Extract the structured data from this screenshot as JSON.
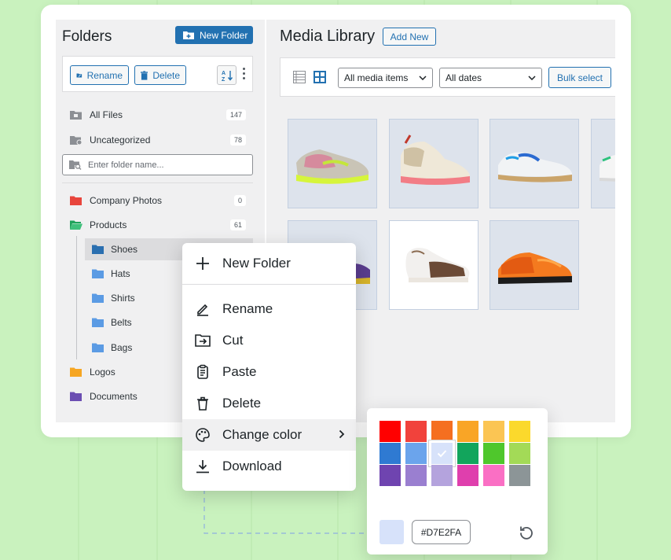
{
  "colors": {
    "accent": "#2271b1",
    "page_bg": "#c9f2be",
    "panel_bg": "#f0f0f1"
  },
  "sidebar": {
    "title": "Folders",
    "new_folder_label": "New Folder",
    "rename_label": "Rename",
    "delete_label": "Delete",
    "search_placeholder": "Enter folder name...",
    "items": [
      {
        "label": "All Files",
        "count": "147",
        "icon": "all-files-icon"
      },
      {
        "label": "Uncategorized",
        "count": "78",
        "icon": "uncategorized-folder-icon"
      },
      {
        "label": "Company Photos",
        "count": "0",
        "color": "#e8453c"
      },
      {
        "label": "Products",
        "count": "61",
        "color": "#1fa35b"
      },
      {
        "label": "Shoes",
        "color": "#2a6fb0"
      },
      {
        "label": "Hats",
        "color": "#5b9be4"
      },
      {
        "label": "Shirts",
        "color": "#5b9be4"
      },
      {
        "label": "Belts",
        "color": "#5b9be4"
      },
      {
        "label": "Bags",
        "color": "#5b9be4"
      },
      {
        "label": "Logos",
        "color": "#f6a623"
      },
      {
        "label": "Documents",
        "color": "#6b4eb2"
      }
    ]
  },
  "main": {
    "title": "Media Library",
    "add_new_label": "Add New",
    "filter_type": "All media items",
    "filter_date": "All dates",
    "bulk_select_label": "Bulk select"
  },
  "context_menu": {
    "items": [
      {
        "label": "New Folder",
        "icon": "plus-icon"
      },
      {
        "label": "Rename",
        "icon": "pencil-icon"
      },
      {
        "label": "Cut",
        "icon": "cut-folder-icon"
      },
      {
        "label": "Paste",
        "icon": "clipboard-icon"
      },
      {
        "label": "Delete",
        "icon": "trash-icon"
      },
      {
        "label": "Change color",
        "icon": "palette-icon"
      },
      {
        "label": "Download",
        "icon": "download-icon"
      }
    ]
  },
  "color_picker": {
    "swatches": [
      "#ff0000",
      "#f1423c",
      "#f56f20",
      "#f9a526",
      "#fbc553",
      "#fbd92c",
      "#2f7ad2",
      "#6ba4ec",
      "#d7e2fa",
      "#12a55c",
      "#4fc72c",
      "#a3da57",
      "#6f44b0",
      "#9a7fd0",
      "#b4a3dd",
      "#df3fad",
      "#fa6fc4",
      "#8c9597"
    ],
    "selected_index": 8,
    "hex_value": "#D7E2FA",
    "preview_color": "#D7E2FA"
  }
}
